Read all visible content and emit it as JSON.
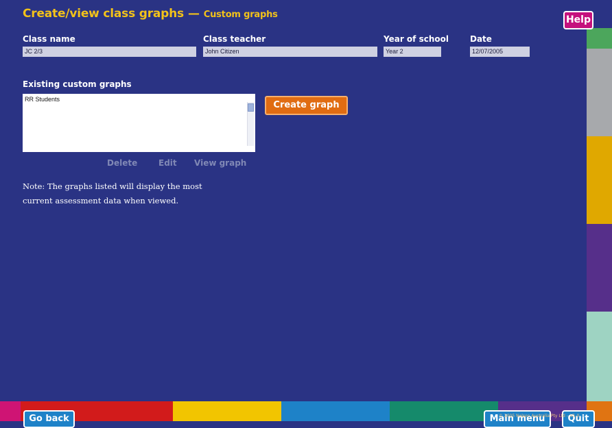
{
  "header": {
    "title": "Create/view class graphs",
    "separator": "—",
    "subtitle": "Custom graphs",
    "help_label": "Help"
  },
  "fields": {
    "class_name": {
      "label": "Class name",
      "value": "JC 2/3"
    },
    "class_teacher": {
      "label": "Class teacher",
      "value": "John Citizen"
    },
    "year_of_school": {
      "label": "Year of school",
      "value": "Year 2"
    },
    "date": {
      "label": "Date",
      "value": "12/07/2005"
    }
  },
  "graphs": {
    "label": "Existing custom graphs",
    "items": [
      "RR Students"
    ],
    "create_label": "Create graph",
    "actions": {
      "delete": "Delete",
      "edit": "Edit",
      "view": "View graph"
    }
  },
  "note": "Note: The graphs listed will display the most current assessment data when viewed.",
  "footer": {
    "go_back": "Go back",
    "main_menu": "Main menu",
    "quit": "Quit",
    "copyright": "© 2005 Nelson Australia Pty Ltd – V1.0"
  },
  "colors": {
    "background": "#2a3384",
    "title": "#f2c21a",
    "help_button": "#c5117d",
    "create_button": "#e06c12",
    "nav_button": "#1e82c8",
    "disabled_text": "#8088b5",
    "right_strip": [
      "#4ca65c",
      "#a7a9ac",
      "#e0a800",
      "#562f8a",
      "#2a3384",
      "#9ed3c2"
    ],
    "bottom_bar": [
      "#cf1474",
      "#d21b1b",
      "#f2c500",
      "#1e82c8",
      "#158a6b",
      "#562f8a",
      "#e07412"
    ]
  },
  "icons": {
    "scrollbar": "scrollbar-thumb"
  }
}
